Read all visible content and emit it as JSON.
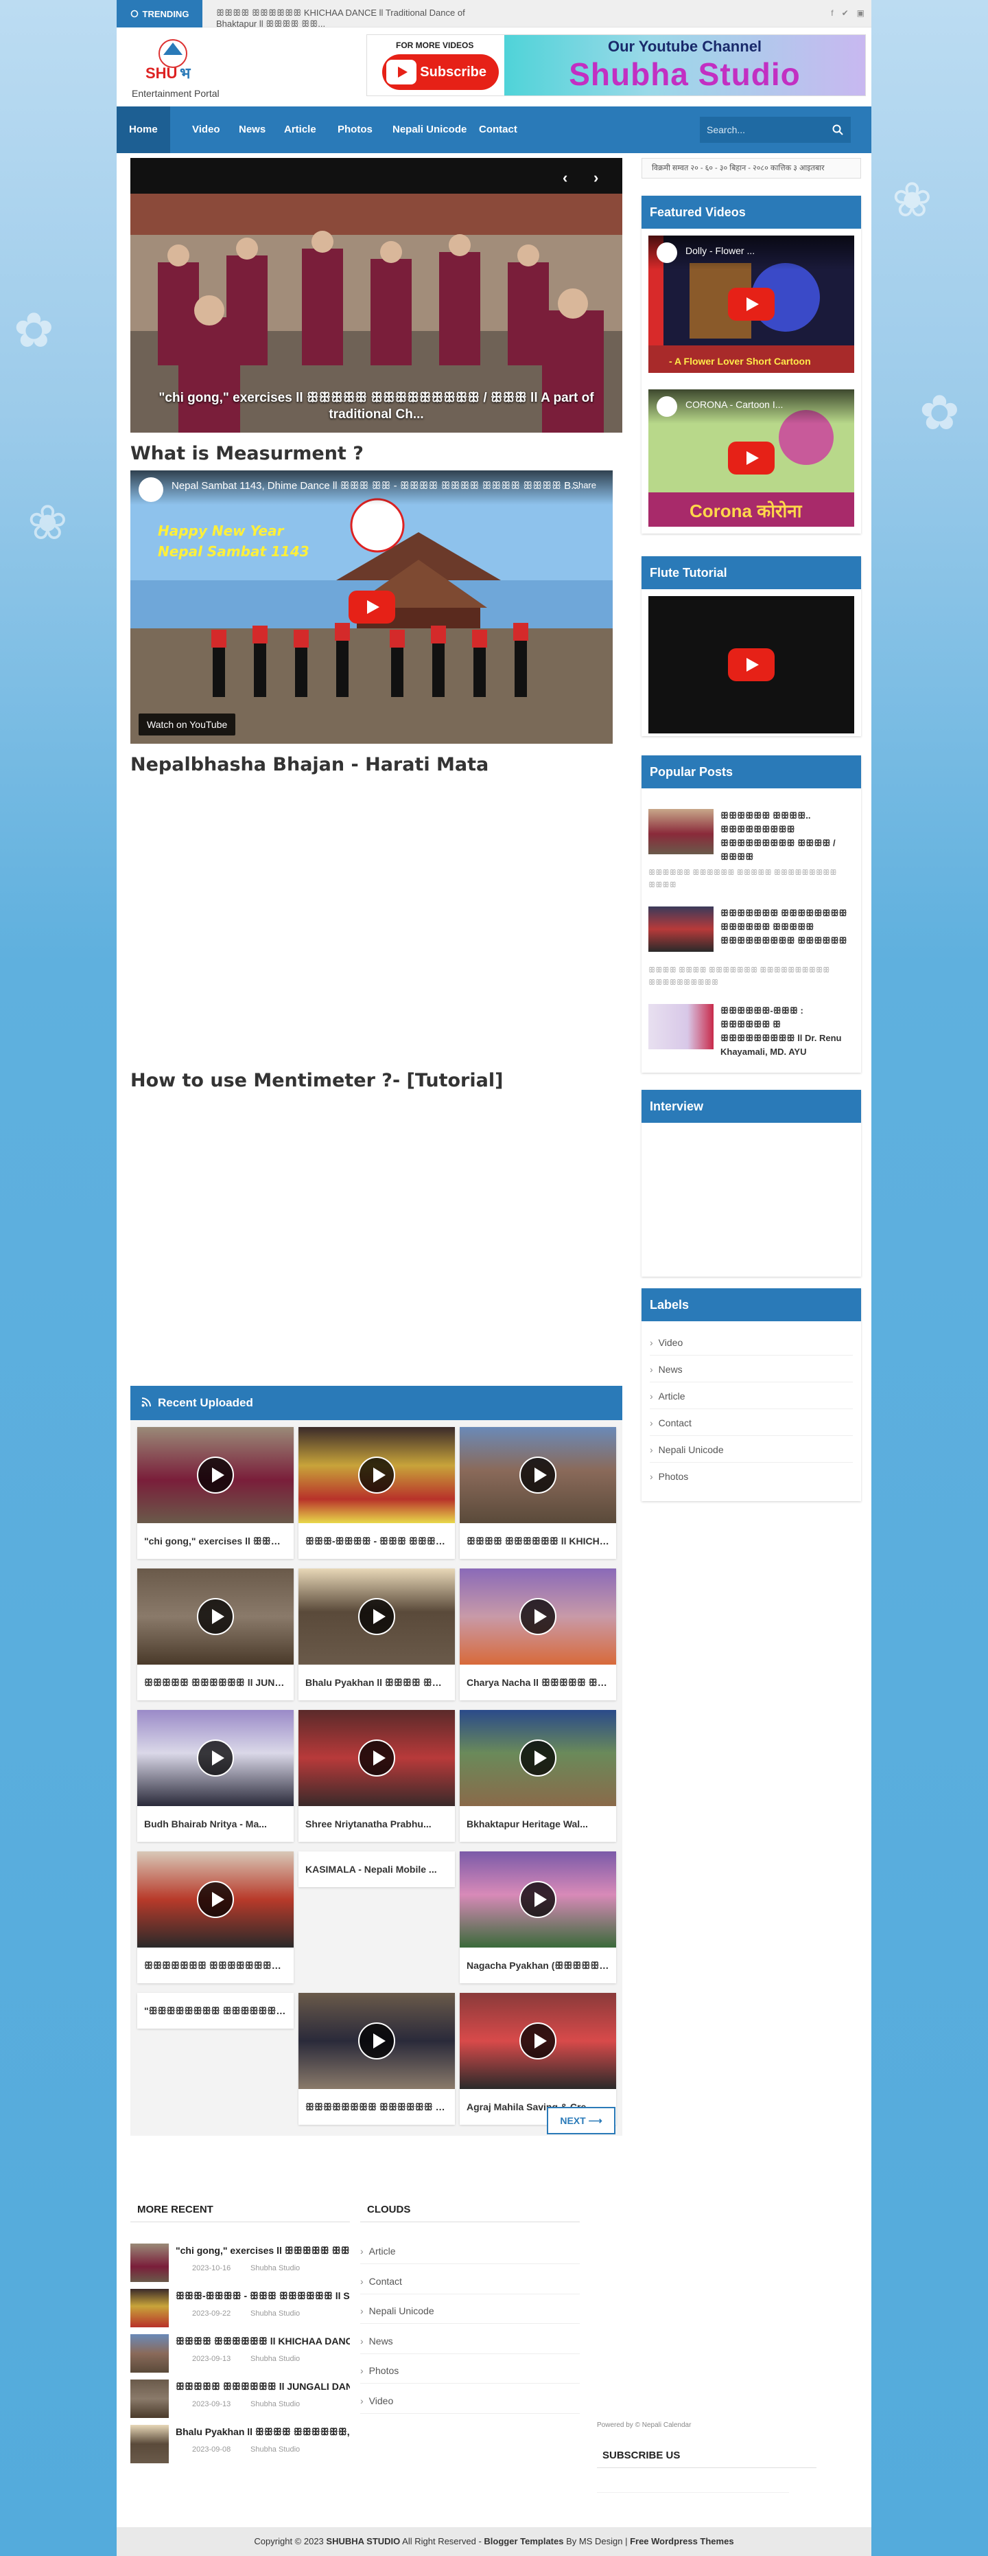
{
  "topbar": {
    "trending_label": "TRENDING",
    "trending_text": "ꕥꕥꕥꕥ ꕥꕥꕥꕥꕥꕥ KHICHAA DANCE ll Traditional Dance of Bhaktapur ll ꕥꕥꕥꕥ ꕥꕥ...",
    "social_icons": [
      "facebook-icon",
      "twitter-icon",
      "youtube-icon"
    ]
  },
  "header": {
    "logo_text": "SHUBHA",
    "logo_sub": "Entertainment Portal",
    "banner_more": "FOR MORE VIDEOS",
    "banner_subscribe": "Subscribe",
    "banner_channel": "Our Youtube Channel",
    "banner_studio": "Shubha Studio"
  },
  "nav": {
    "items": [
      "Home",
      "Video",
      "News",
      "Article",
      "Photos",
      "Nepali Unicode",
      "Contact"
    ],
    "search_placeholder": "Search..."
  },
  "slider": {
    "caption": "\"chi gong,\" exercises ll ꕥꕥꕥꕥꕥ ꕥꕥꕥꕥꕥꕥꕥꕥꕥ / ꕥꕥꕥ ll A part of traditional Ch...",
    "prev": "‹",
    "next": "›"
  },
  "sections": {
    "measurement_title": "What is Measurment ?",
    "video1_title": "Nepal Sambat 1143, Dhime Dance ll ꕥꕥꕥ ꕥꕥ - ꕥꕥꕥꕥ ꕥꕥꕥꕥ ꕥꕥꕥꕥ ꕥꕥꕥꕥ B...",
    "video1_share": "Share",
    "video1_watch": "Watch on YouTube",
    "bhajan_title": "Nepalbhasha Bhajan - Harati Mata",
    "mentimeter_title": "How to use Mentimeter ?- [Tutorial]"
  },
  "recent": {
    "title": "Recent Uploaded",
    "cards": [
      "\"chi gong,\" exercises ll ꕥꕥꕥꕥꕥ...",
      "ꕥꕥꕥ-ꕥꕥꕥꕥ - ꕥꕥꕥ ꕥꕥꕥꕥꕥꕥ ll S...",
      "ꕥꕥꕥꕥ ꕥꕥꕥꕥꕥꕥ ll KHICHAA D...",
      "ꕥꕥꕥꕥꕥ ꕥꕥꕥꕥꕥꕥ ll JUNGALI D...",
      "Bhalu Pyakhan ll ꕥꕥꕥꕥ ꕥꕥ...",
      "Charya Nacha ll ꕥꕥꕥꕥꕥ ꕥꕥꕥ...",
      "Budh Bhairab Nritya - Ma...",
      "Shree Nriytanatha Prabhu...",
      "Bkhaktapur Heritage Wal...",
      "ꕥꕥꕥꕥꕥꕥꕥ ꕥꕥꕥꕥꕥꕥꕥꕥꕥ ꕥꕥꕥꕥ...",
      "KASIMALA - Nepali Mobile ...",
      "Nagacha Pyakhan (ꕥꕥꕥꕥꕥꕥ...",
      "\"ꕥꕥꕥꕥꕥꕥꕥꕥ ꕥꕥꕥꕥꕥꕥꕥ ꕥꕥꕥꕥꕥ...",
      "ꕥꕥꕥꕥꕥꕥꕥꕥ ꕥꕥꕥꕥꕥꕥ ꕥꕥꕥꕥꕥꕥꕥꕥ...",
      "Agraj Mahila Saving & Cre..."
    ],
    "next_label": "NEXT ⟶"
  },
  "sidebar": {
    "date": "विक्रमी सम्वत २० - ६० - ३० बिहान - २०८० कात्तिक ३ आइतबार",
    "featured_title": "Featured Videos",
    "featured_video1": "Dolly - Flower ...",
    "featured_video1_sub": "- A Flower Lover   Short Cartoon",
    "featured_video2": "CORONA - Cartoon I...",
    "featured_video2_sub": "Corona कोरोना",
    "flute_title": "Flute Tutorial",
    "popular_title": "Popular Posts",
    "popular": [
      {
        "title": "ꕥꕥꕥꕥꕥꕥ ꕥꕥꕥꕥ.. ꕥꕥꕥꕥꕥꕥꕥꕥꕥ ꕥꕥꕥꕥꕥꕥꕥꕥꕥ ꕥꕥꕥꕥ / ꕥꕥꕥꕥ",
        "desc": "ꕥꕥꕥꕥꕥꕥ ꕥꕥꕥꕥꕥꕥ ꕥꕥꕥꕥꕥ ꕥꕥꕥꕥꕥꕥꕥꕥꕥ ꕥꕥꕥꕥ"
      },
      {
        "title": "ꕥꕥꕥꕥꕥꕥꕥ ꕥꕥꕥꕥꕥꕥꕥꕥ ꕥꕥꕥꕥꕥꕥ ꕥꕥꕥꕥꕥ ꕥꕥꕥꕥꕥꕥꕥꕥꕥ ꕥꕥꕥꕥꕥꕥ",
        "desc": "ꕥꕥꕥꕥ ꕥꕥꕥꕥ ꕥꕥꕥꕥꕥꕥꕥ ꕥꕥꕥꕥꕥꕥꕥꕥꕥꕥ ꕥꕥꕥꕥꕥꕥꕥꕥꕥꕥ"
      },
      {
        "title": "ꕥꕥꕥꕥꕥꕥ-ꕥꕥꕥ : ꕥꕥꕥꕥꕥꕥ ꕥ ꕥꕥꕥꕥꕥꕥꕥꕥꕥ ll Dr. Renu Khayamali, MD. AYU",
        "desc": ""
      }
    ],
    "interview_title": "Interview",
    "labels_title": "Labels",
    "labels": [
      "Video",
      "News",
      "Article",
      "Contact",
      "Nepali Unicode",
      "Photos"
    ]
  },
  "footer": {
    "more_recent_title": "MORE RECENT",
    "more_recent": [
      {
        "title": "\"chi gong,\" exercises ll ꕥꕥꕥꕥꕥ ꕥꕥ",
        "date": "2023-10-16",
        "author": "Shubha Studio"
      },
      {
        "title": "ꕥꕥꕥ-ꕥꕥꕥꕥ - ꕥꕥꕥ ꕥꕥꕥꕥꕥꕥ ll Sher-S",
        "date": "2023-09-22",
        "author": "Shubha Studio"
      },
      {
        "title": "ꕥꕥꕥꕥ ꕥꕥꕥꕥꕥꕥ ll KHICHAA DANCE ll",
        "date": "2023-09-13",
        "author": "Shubha Studio"
      },
      {
        "title": "ꕥꕥꕥꕥꕥ ꕥꕥꕥꕥꕥꕥ ll JUNGALI DANCE l",
        "date": "2023-09-13",
        "author": "Shubha Studio"
      },
      {
        "title": "Bhalu Pyakhan ll ꕥꕥꕥꕥ ꕥꕥꕥꕥꕥꕥ, ꕥ",
        "date": "2023-09-08",
        "author": "Shubha Studio"
      }
    ],
    "clouds_title": "CLOUDS",
    "clouds": [
      "Article",
      "Contact",
      "Nepali Unicode",
      "News",
      "Photos",
      "Video"
    ],
    "powered": "Powered by © Nepali Calendar",
    "subscribe_title": "SUBSCRIBE US"
  },
  "copyright": {
    "prefix": "Copyright © 2023",
    "brand": "SHUBHA STUDIO",
    "rights": "All Right Reserved -",
    "blogger": "Blogger Templates",
    "by": "By MS Design |",
    "wp": "Free Wordpress Themes"
  },
  "colors": {
    "accent": "#2a7ab8",
    "youtube": "#e62117",
    "studio": "#c22fc2"
  }
}
